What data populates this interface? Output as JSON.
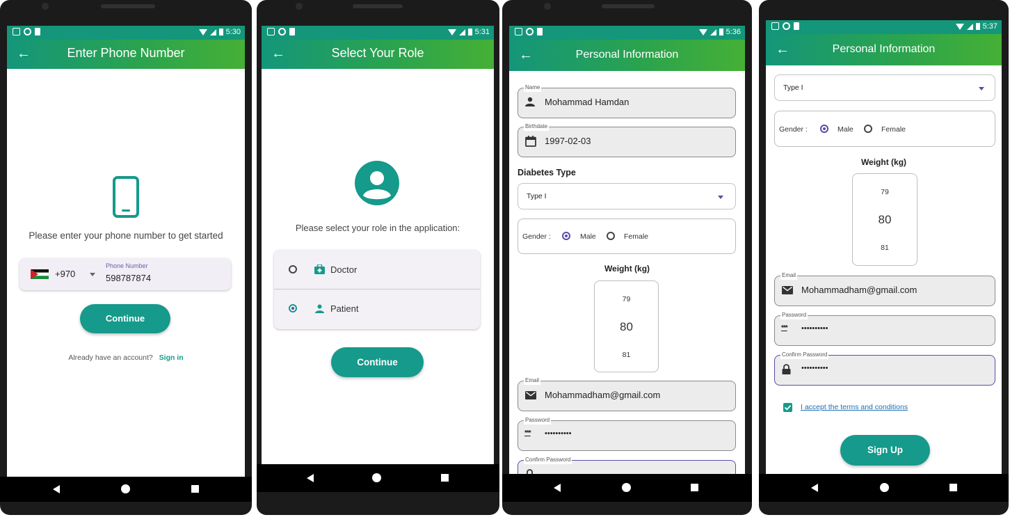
{
  "screen1": {
    "time": "5:30",
    "title": "Enter Phone Number",
    "prompt": "Please enter your phone number to get started",
    "country_code": "+970",
    "phone_label": "Phone Number",
    "phone_value": "598787874",
    "continue_label": "Continue",
    "signin_prompt": "Already have an account?",
    "signin_link": "Sign in"
  },
  "screen2": {
    "time": "5:31",
    "title": "Select Your Role",
    "prompt": "Please select your role in the application:",
    "roles": [
      {
        "label": "Doctor",
        "selected": false,
        "icon": "medical-bag-icon"
      },
      {
        "label": "Patient",
        "selected": true,
        "icon": "person-icon"
      }
    ],
    "continue_label": "Continue"
  },
  "screen3": {
    "time": "5:36",
    "title": "Personal Information",
    "name_label": "Name",
    "name_value": "Mohammad Hamdan",
    "birth_label": "Birthdate",
    "birth_value": "1997-02-03",
    "diabetes_heading": "Diabetes Type",
    "diabetes_value": "Type I",
    "gender_label": "Gender :",
    "gender_male": "Male",
    "gender_female": "Female",
    "weight_heading": "Weight (kg)",
    "weight_prev": "79",
    "weight_current": "80",
    "weight_next": "81",
    "email_label": "Email",
    "email_value": "Mohammadham@gmail.com",
    "password_label": "Password",
    "password_value": "••••••••••",
    "confirm_label": "Confirm Password"
  },
  "screen4": {
    "time": "5:37",
    "title": "Personal Information",
    "diabetes_value": "Type I",
    "gender_label": "Gender :",
    "gender_male": "Male",
    "gender_female": "Female",
    "weight_heading": "Weight (kg)",
    "weight_prev": "79",
    "weight_current": "80",
    "weight_next": "81",
    "email_label": "Email",
    "email_value": "Mohammadham@gmail.com",
    "password_label": "Password",
    "password_value": "••••••••••",
    "confirm_label": "Confirm Password",
    "confirm_value": "••••••••••",
    "terms_label": "I accept the terms and conditions",
    "signup_label": "Sign Up"
  },
  "colors": {
    "accent_teal": "#159a8b",
    "appbar_start": "#14967a",
    "appbar_end": "#45b035",
    "radio_purple": "#5b4ba6",
    "link_blue": "#1a6fb5"
  }
}
